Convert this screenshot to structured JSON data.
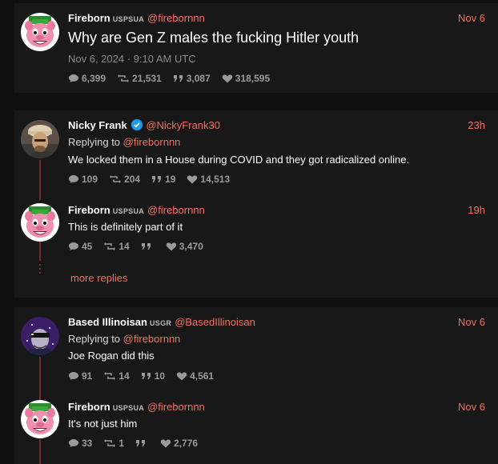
{
  "colors": {
    "accent": "#f26f5f",
    "background": "#0f0f0f",
    "card": "#181818",
    "thread": "#7a2a2a"
  },
  "main_post": {
    "name": "Fireborn",
    "badge": "USPSUA",
    "handle": "@firebornnn",
    "date": "Nov 6",
    "text": "Why are Gen Z males the fucking Hitler youth",
    "timestamp": "Nov 6, 2024 · 9:10 AM UTC",
    "stats": {
      "replies": "6,399",
      "reposts": "21,531",
      "quotes": "3,087",
      "likes": "318,595"
    }
  },
  "thread1": {
    "reply1": {
      "name": "Nicky Frank",
      "verified": true,
      "handle": "@NickyFrank30",
      "date": "23h",
      "replying_label": "Replying to",
      "replying_handle": "@firebornnn",
      "text": "We locked them in a House during COVID and they got radicalized online.",
      "stats": {
        "replies": "109",
        "reposts": "204",
        "quotes": "19",
        "likes": "14,513"
      }
    },
    "reply2": {
      "name": "Fireborn",
      "badge": "USPSUA",
      "handle": "@firebornnn",
      "date": "19h",
      "text": "This is definitely part of it",
      "stats": {
        "replies": "45",
        "reposts": "14",
        "quotes": "",
        "likes": "3,470"
      }
    },
    "more_replies": "more replies"
  },
  "thread2": {
    "reply1": {
      "name": "Based Illinoisan",
      "badge": "USGR",
      "handle": "@BasedIllinoisan",
      "date": "Nov 6",
      "replying_label": "Replying to",
      "replying_handle": "@firebornnn",
      "text": "Joe Rogan did this",
      "stats": {
        "replies": "91",
        "reposts": "14",
        "quotes": "10",
        "likes": "4,561"
      }
    },
    "reply2": {
      "name": "Fireborn",
      "badge": "USPSUA",
      "handle": "@firebornnn",
      "date": "Nov 6",
      "text": "It's not just him",
      "stats": {
        "replies": "33",
        "reposts": "1",
        "quotes": "",
        "likes": "2,776"
      }
    }
  },
  "icons": {
    "reply": "reply-icon",
    "repost": "repost-icon",
    "quote": "quote-icon",
    "like": "heart-icon",
    "verified": "verified-badge-icon"
  }
}
